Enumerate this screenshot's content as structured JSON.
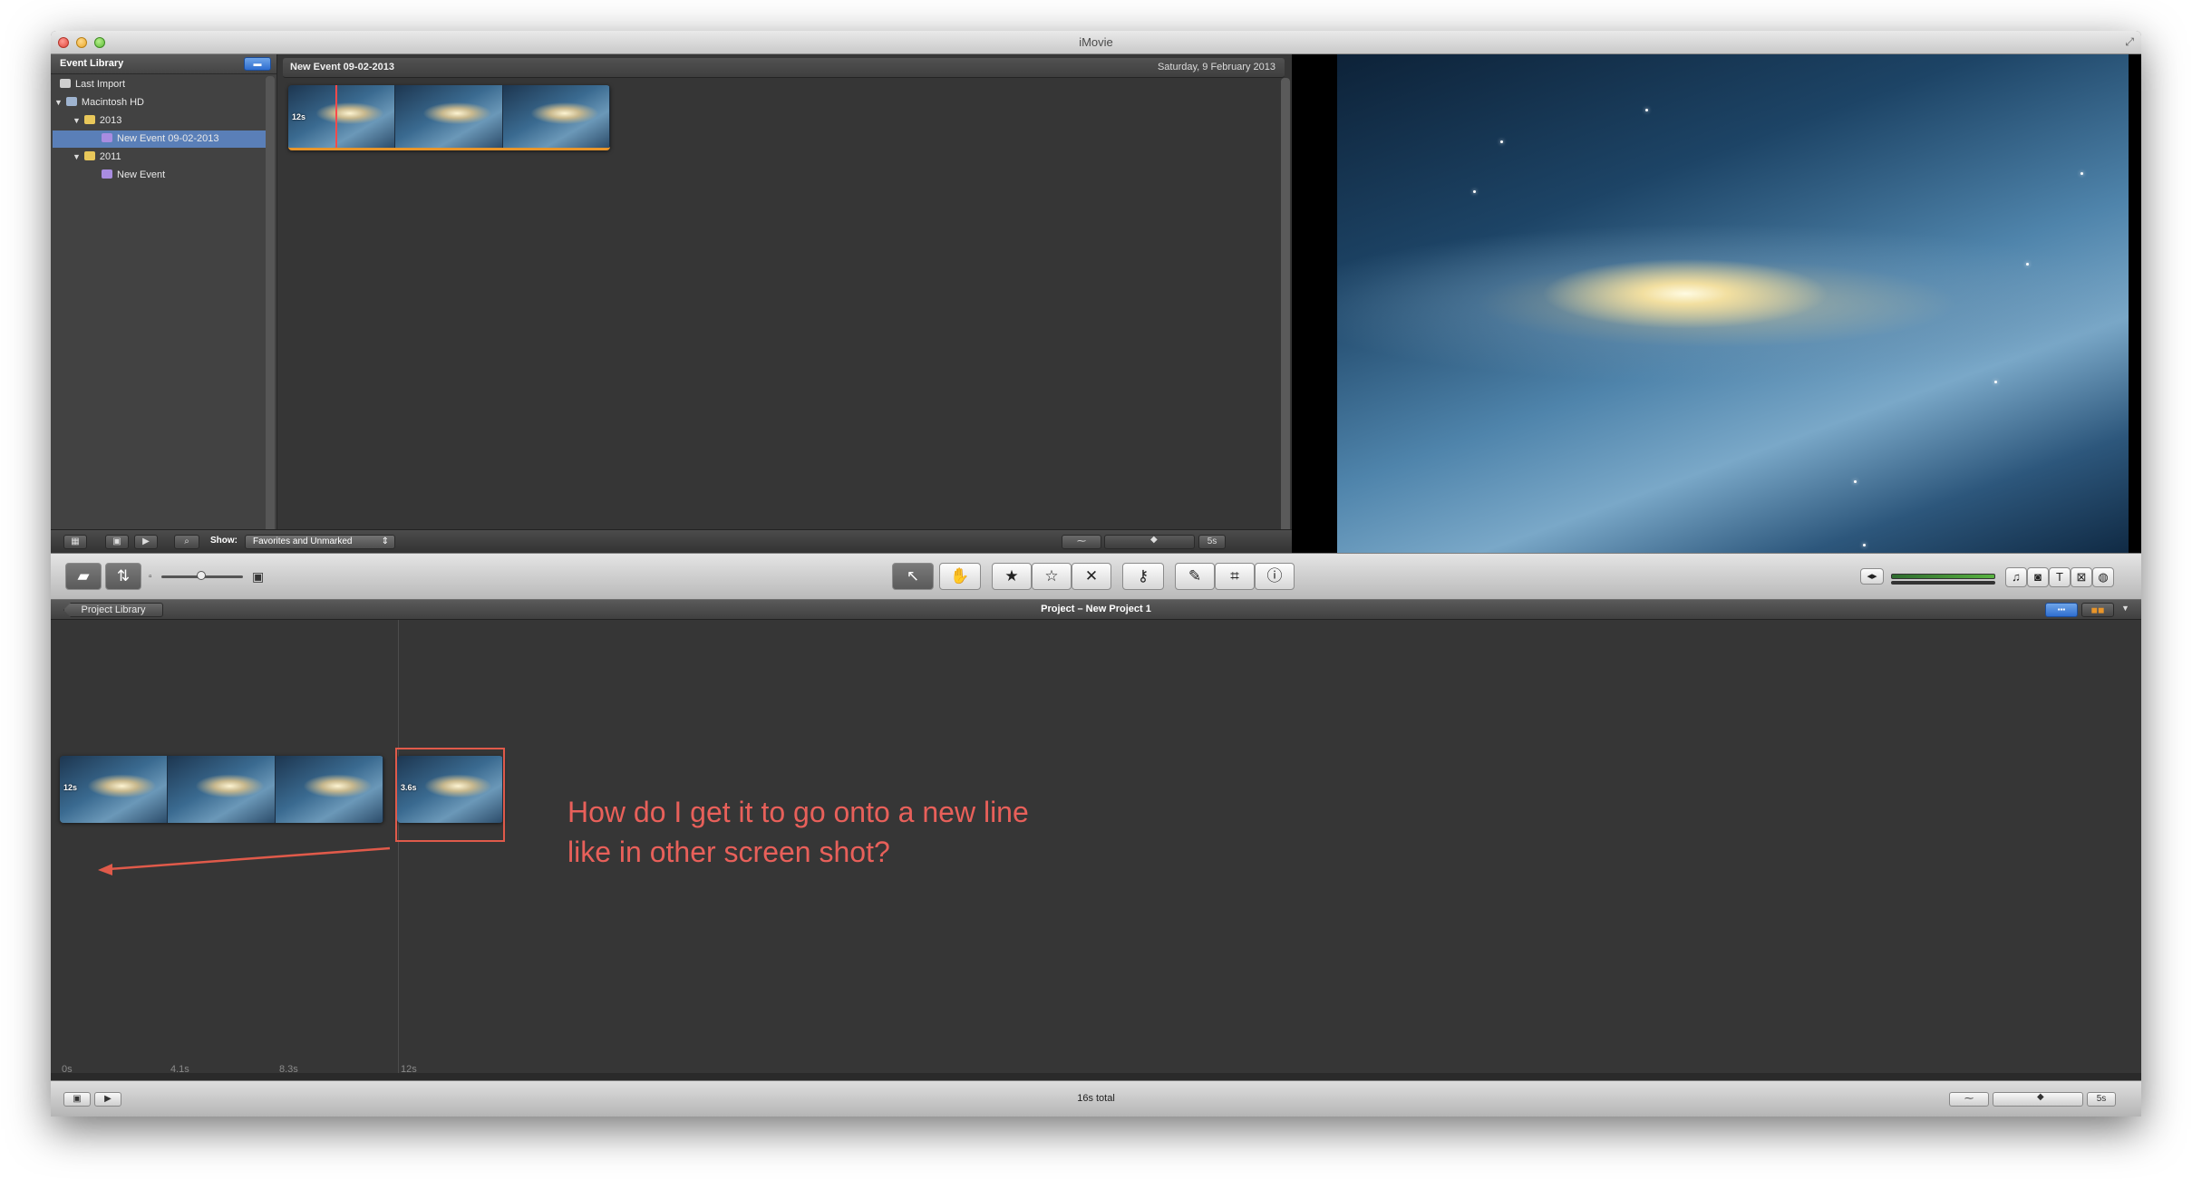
{
  "window": {
    "title": "iMovie"
  },
  "event_library": {
    "title": "Event Library",
    "items": [
      {
        "label": "Last Import"
      },
      {
        "label": "Macintosh HD"
      },
      {
        "label": "2013"
      },
      {
        "label": "New Event 09-02-2013"
      },
      {
        "label": "2011"
      },
      {
        "label": "New Event"
      }
    ]
  },
  "event_browser": {
    "event_name": "New Event 09-02-2013",
    "date": "Saturday, 9 February 2013",
    "clip_duration": "12s",
    "show_label": "Show:",
    "show_value": "Favorites and Unmarked",
    "zoom_value": "5s"
  },
  "project": {
    "library_button": "Project Library",
    "title": "Project – New Project 1",
    "clips": [
      {
        "duration": "12s"
      },
      {
        "duration": "3.6s"
      }
    ],
    "ticks": [
      "0s",
      "4.1s",
      "8.3s",
      "12s"
    ],
    "total": "16s total",
    "zoom_value": "5s"
  },
  "annotation": {
    "text": "How do I get it to go onto a new line like in other screen shot?"
  },
  "colors": {
    "annotation": "#e05a4a",
    "selection": "#5a7fb8",
    "accent": "#2f6ed0"
  },
  "icons": {
    "toolbar": [
      "camera-icon",
      "swap-icon",
      "arrow-icon",
      "hand-drag-icon",
      "star-filled-icon",
      "star-empty-icon",
      "reject-icon",
      "key-icon",
      "eyedropper-icon",
      "crop-icon",
      "info-icon"
    ],
    "right": [
      "music-icon",
      "photo-icon",
      "title-icon",
      "transition-icon",
      "globe-icon"
    ]
  }
}
